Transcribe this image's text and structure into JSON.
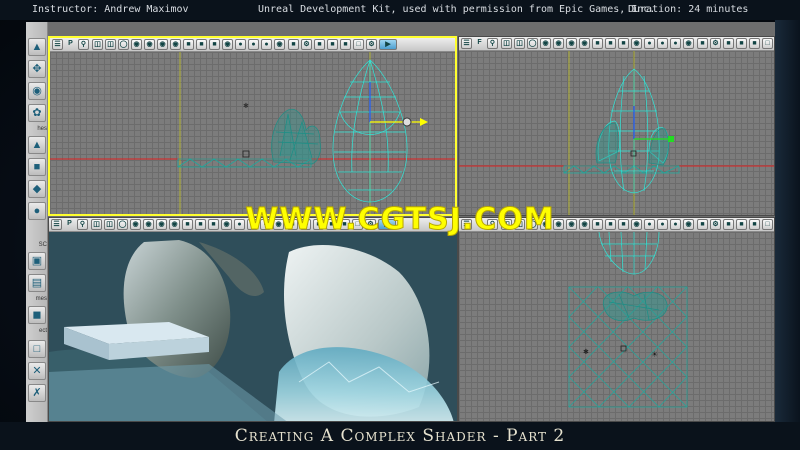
{
  "info_bar": {
    "instructor": "Instructor: Andrew Maximov",
    "kit_credit": "Unreal Development Kit, used with permission from Epic Games, Inc.",
    "duration": "Duration: 24 minutes"
  },
  "left_toolbar": {
    "labels": [
      "hes",
      "SC",
      "mes",
      "ect"
    ]
  },
  "viewports": {
    "top": {
      "toolbar_label": "P",
      "active": true
    },
    "side": {
      "toolbar_label": "F"
    },
    "perspective": {
      "toolbar_label": "P"
    },
    "front": {
      "toolbar_label": "F"
    }
  },
  "watermark": "WWW.CGTSJ.COM",
  "lesson_title": "Creating A Complex Shader - Part 2",
  "colors": {
    "selected_viewport_border": "#ffff2e",
    "wireframe": "#2fe6d8",
    "watermark": "#ffff00"
  }
}
